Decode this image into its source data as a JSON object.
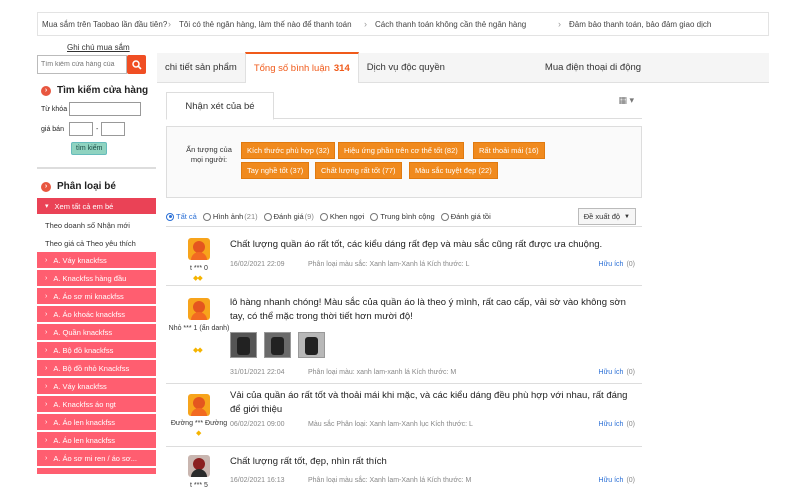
{
  "help_bar": [
    {
      "label": "Mua sắm trên Taobao lần đầu tiên?"
    },
    {
      "label": "Tôi có thẻ ngân hàng, làm thế nào để thanh toán"
    },
    {
      "label": "Cách thanh toán không cần thẻ ngân hàng"
    },
    {
      "label": "Đảm bảo thanh toán, bảo đảm giao dịch"
    }
  ],
  "note_link": "Ghi chú mua sắm",
  "shop_search": {
    "placeholder": "Tìm kiếm cửa hàng của",
    "icon": "search-icon"
  },
  "shop_panel": {
    "title": "Tìm kiếm cửa hàng",
    "keyword_label": "Từ khóa",
    "price_label": "giá bán",
    "price_sep": "-",
    "search_button": "tìm kiếm"
  },
  "category_panel": {
    "title": "Phân loại bé",
    "view_all": "Xem tất cả em bé",
    "sort_sales": "Theo doanh số Nhận mới",
    "sort_price": "Theo giá cả Theo yêu thích",
    "items": [
      "A. Váy knackfss",
      "A. Knackfss hàng đầu",
      "A. Áo sơ mi knackfss",
      "A. Áo khoác knackfss",
      "A. Quần knackfss",
      "A. Bộ đồ knackfss",
      "A. Bộ đồ nhỏ Knackfss",
      "A. Váy knackfss",
      "A. Knackfss áo ngt",
      "A. Áo len knackfss",
      "A. Áo len knackfss",
      "A. Áo sơ mi ren / áo sơ..."
    ]
  },
  "tabs": {
    "detail": "chi tiết sản phẩm",
    "reviews": "Tổng số bình luận",
    "reviews_count": "314",
    "exclusive": "Dịch vụ độc quyền",
    "phone": "Mua điện thoại di động"
  },
  "subtab": {
    "label": "Nhận xét của bé",
    "grid_icon": "grid-icon"
  },
  "impression": {
    "label": "Ấn tượng của mọi người:",
    "tags": [
      "Kích thước phù hợp (32)",
      "Hiệu ứng phần trên cơ thể tốt (82)",
      "Rất thoải mái (16)",
      "Tay nghề tốt (37)",
      "Chất lượng rất tốt (77)",
      "Màu sắc tuyệt đẹp (22)"
    ]
  },
  "filters": [
    {
      "label": "Tất cả",
      "count": "",
      "selected": true
    },
    {
      "label": "Hình ảnh",
      "count": "(21)",
      "selected": false
    },
    {
      "label": "Đánh giá",
      "count": "(9)",
      "selected": false
    },
    {
      "label": "Khen ngợi",
      "count": "",
      "selected": false
    },
    {
      "label": "Trung bình cộng",
      "count": "",
      "selected": false
    },
    {
      "label": "Đánh giá tồi",
      "count": "",
      "selected": false
    }
  ],
  "recommend": "Đề xuất độ",
  "reviews": [
    {
      "user": "t *** 0",
      "text": "Chất lượng quần áo rất tốt, các kiểu dáng rất đẹp và màu sắc cũng rất được ưa chuộng.",
      "date": "16/02/2021 22:09",
      "variant": "Phân loại màu sắc: Xanh lam-Xanh lá Kích thước: L",
      "helpful": "Hữu ích",
      "helpful_count": "(0)"
    },
    {
      "user": "Nhỏ *** 1 (ẩn danh)",
      "text": "lô hàng nhanh chóng! Màu sắc của quần áo là theo ý mình, rất cao cấp, vải sờ vào không sờn tay, có thể mặc trong thời tiết hơn mười độ!",
      "date": "31/01/2021 22:04",
      "variant": "Phân loại màu: xanh lam-xanh lá Kích thước: M",
      "helpful": "Hữu ích",
      "helpful_count": "(0)"
    },
    {
      "user": "Đường *** Đường",
      "text": "Vải của quần áo rất tốt và thoải mái khi mặc, và các kiểu dáng đều phù hợp với nhau, rất đáng để giới thiệu",
      "date": "06/02/2021 09:00",
      "variant": "Màu sắc Phân loại: Xanh lam-Xanh lục Kích thước: L",
      "helpful": "Hữu ích",
      "helpful_count": "(0)"
    },
    {
      "user": "t *** 5",
      "text": "Chất lượng rất tốt, đẹp, nhìn rất thích",
      "date": "16/02/2021 16:13",
      "variant": "Phân loại màu sắc: Xanh lam-Xanh lá Kích thước: M",
      "helpful": "Hữu ích",
      "helpful_count": "(0)"
    }
  ],
  "colors": {
    "accent": "#f05a1a",
    "tag": "#f08a1e",
    "category": "#ff5e70",
    "link": "#2a6fd6"
  }
}
